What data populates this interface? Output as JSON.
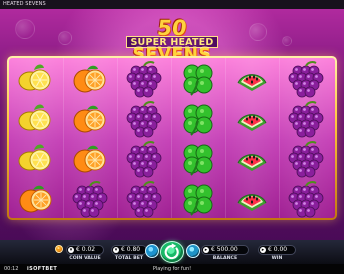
{
  "window": {
    "title": "HEATED SEVENS"
  },
  "logo": {
    "number": "50",
    "line1": "SUPER HEATED",
    "line2": "SEVENS"
  },
  "reels": [
    {
      "symbols": [
        "lemon",
        "lemon",
        "lemon",
        "orange"
      ]
    },
    {
      "symbols": [
        "orange",
        "orange",
        "orange",
        "grape"
      ]
    },
    {
      "symbols": [
        "grape",
        "grape",
        "grape",
        "grape"
      ]
    },
    {
      "symbols": [
        "clover",
        "clover",
        "clover",
        "clover"
      ]
    },
    {
      "symbols": [
        "watermelon",
        "watermelon",
        "watermelon",
        "watermelon"
      ]
    },
    {
      "symbols": [
        "grape",
        "grape",
        "grape",
        "grape"
      ]
    }
  ],
  "controls": {
    "coin_value": {
      "value": "€ 0.02",
      "label": "COIN VALUE"
    },
    "total_bet": {
      "value": "€ 0.80",
      "label": "TOTAL BET"
    },
    "balance": {
      "value": "€ 500.00",
      "label": "BALANCE"
    },
    "win": {
      "value": "€ 0.00",
      "label": "WIN"
    },
    "icons": {
      "coin": "coin-icon",
      "autoplay": "autoplay-icon",
      "spin": "spin-icon",
      "fast": "fast-play-icon"
    }
  },
  "status": {
    "time": "00:12",
    "brand": "iSOFTBET",
    "message": "Playing for fun!"
  },
  "colors": {
    "background_top": "#b02a9e",
    "background_bottom": "#4a0b57",
    "frame_gold": "#ffc83c",
    "spin_green": "#19b968"
  }
}
